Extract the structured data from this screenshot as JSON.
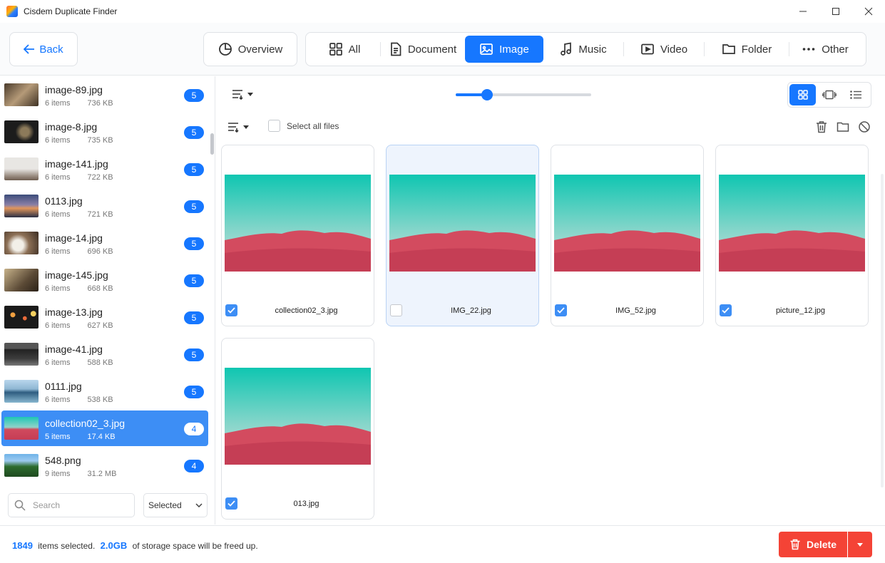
{
  "window": {
    "title": "Cisdem Duplicate Finder"
  },
  "header": {
    "back_label": "Back",
    "overview_label": "Overview",
    "tabs": [
      {
        "label": "All",
        "icon": "grid-icon"
      },
      {
        "label": "Document",
        "icon": "document-icon"
      },
      {
        "label": "Image",
        "icon": "image-icon",
        "active": true
      },
      {
        "label": "Music",
        "icon": "music-icon"
      },
      {
        "label": "Video",
        "icon": "video-icon"
      },
      {
        "label": "Folder",
        "icon": "folder-icon"
      },
      {
        "label": "Other",
        "icon": "more-icon"
      }
    ]
  },
  "sidebar": {
    "items": [
      {
        "name": "image-89.jpg",
        "items": "6 items",
        "size": "736 KB",
        "count": "5"
      },
      {
        "name": "image-8.jpg",
        "items": "6 items",
        "size": "735 KB",
        "count": "5"
      },
      {
        "name": "image-141.jpg",
        "items": "6 items",
        "size": "722 KB",
        "count": "5"
      },
      {
        "name": "0113.jpg",
        "items": "6 items",
        "size": "721 KB",
        "count": "5"
      },
      {
        "name": "image-14.jpg",
        "items": "6 items",
        "size": "696 KB",
        "count": "5"
      },
      {
        "name": "image-145.jpg",
        "items": "6 items",
        "size": "668 KB",
        "count": "5"
      },
      {
        "name": "image-13.jpg",
        "items": "6 items",
        "size": "627 KB",
        "count": "5"
      },
      {
        "name": "image-41.jpg",
        "items": "6 items",
        "size": "588 KB",
        "count": "5"
      },
      {
        "name": "0111.jpg",
        "items": "6 items",
        "size": "538 KB",
        "count": "5"
      },
      {
        "name": "collection02_3.jpg",
        "items": "5 items",
        "size": "17.4 KB",
        "count": "4",
        "selected": true
      },
      {
        "name": "548.png",
        "items": "9 items",
        "size": "31.2 MB",
        "count": "4"
      }
    ],
    "search_placeholder": "Search",
    "filter_value": "Selected"
  },
  "main": {
    "select_all_label": "Select all files",
    "zoom_fraction": 0.23,
    "cards": [
      {
        "name": "collection02_3.jpg",
        "checked": true
      },
      {
        "name": "IMG_22.jpg",
        "checked": false,
        "highlighted": true
      },
      {
        "name": "IMG_52.jpg",
        "checked": true
      },
      {
        "name": "picture_12.jpg",
        "checked": true
      },
      {
        "name": "013.jpg",
        "checked": true
      }
    ]
  },
  "footer": {
    "count": "1849",
    "count_suffix": "items selected.",
    "space": "2.0GB",
    "space_suffix": "of storage space will be freed up.",
    "delete_label": "Delete"
  },
  "colors": {
    "accent": "#1677ff",
    "danger": "#f44336",
    "selected_row": "#3d8ef5"
  }
}
